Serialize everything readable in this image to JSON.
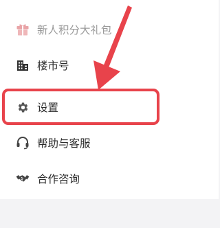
{
  "menu": {
    "items": [
      {
        "label": "新人积分大礼包",
        "icon": "gift-icon",
        "icon_color": "#e9a4a7",
        "state": "dimmed"
      },
      {
        "label": "楼市号",
        "icon": "building-icon",
        "icon_color": "#333333"
      },
      {
        "label": "设置",
        "icon": "gear-icon",
        "icon_color": "#555555",
        "highlighted": true
      },
      {
        "label": "帮助与客服",
        "icon": "headset-icon",
        "icon_color": "#444444"
      },
      {
        "label": "合作咨询",
        "icon": "handshake-icon",
        "icon_color": "#444444"
      }
    ]
  },
  "annotation": {
    "color": "#e8434b",
    "type": "arrow-and-box",
    "target": "设置"
  },
  "colors": {
    "panel_bg": "#ffffff",
    "page_bg": "#f3f3f5",
    "text": "#2c2c2c",
    "dimmed_text": "#9a9a9a"
  }
}
